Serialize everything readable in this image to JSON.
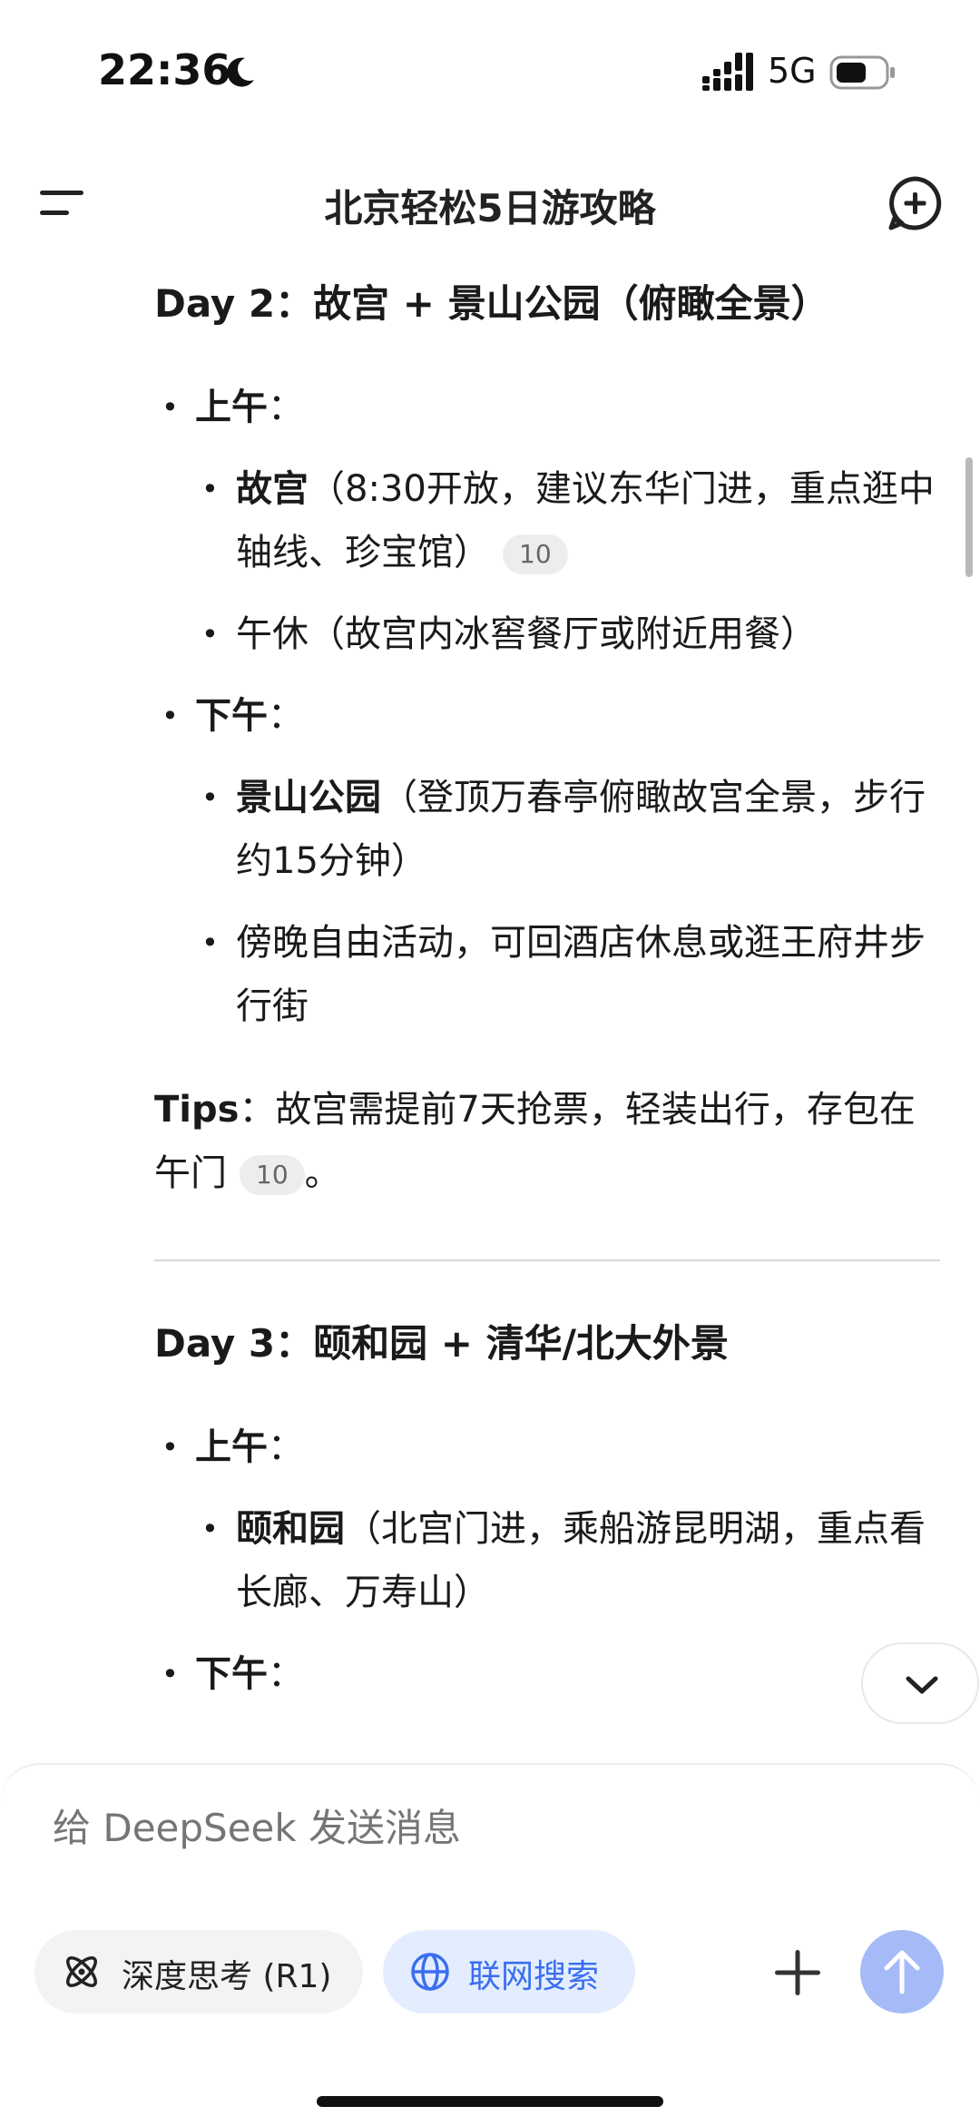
{
  "status_bar": {
    "time": "22:36",
    "network": "5G"
  },
  "header": {
    "title": "北京轻松5日游攻略"
  },
  "content": {
    "day2_title": "Day 2：故宫 + 景山公园（俯瞰全景）",
    "morning_label": "上午",
    "afternoon_label": "下午",
    "colon": "：",
    "day2_am_1_name": "故宫",
    "day2_am_1_desc": "（8:30开放，建议东华门进，重点逛中轴线、珍宝馆）",
    "citation": "10",
    "day2_am_2": "午休（故宫内冰窖餐厅或附近用餐）",
    "day2_pm_1_name": "景山公园",
    "day2_pm_1_desc": "（登顶万春亭俯瞰故宫全景，步行约15分钟）",
    "day2_pm_2": "傍晚自由活动，可回酒店休息或逛王府井步行街",
    "tips_label": "Tips",
    "tips_text": "：故宫需提前7天抢票，轻装出行，存包在午门",
    "tips_end": "。",
    "day3_title": "Day 3：颐和园 + 清华/北大外景",
    "day3_am_1_name": "颐和园",
    "day3_am_1_desc": "（北宫门进，乘船游昆明湖，重点看长廊、万寿山）"
  },
  "composer": {
    "placeholder": "给 DeepSeek 发送消息",
    "deep_think_label": "深度思考 (R1)",
    "web_search_label": "联网搜索"
  },
  "colors": {
    "accent": "#3a6ef0",
    "send_disabled": "#a6baf8",
    "pill_active_bg": "#e4edfe"
  },
  "icons": [
    "moon-icon",
    "signal-icon",
    "battery-icon",
    "menu-icon",
    "new-chat-icon",
    "chevron-down-icon",
    "atom-icon",
    "globe-icon",
    "plus-icon",
    "arrow-up-icon"
  ]
}
